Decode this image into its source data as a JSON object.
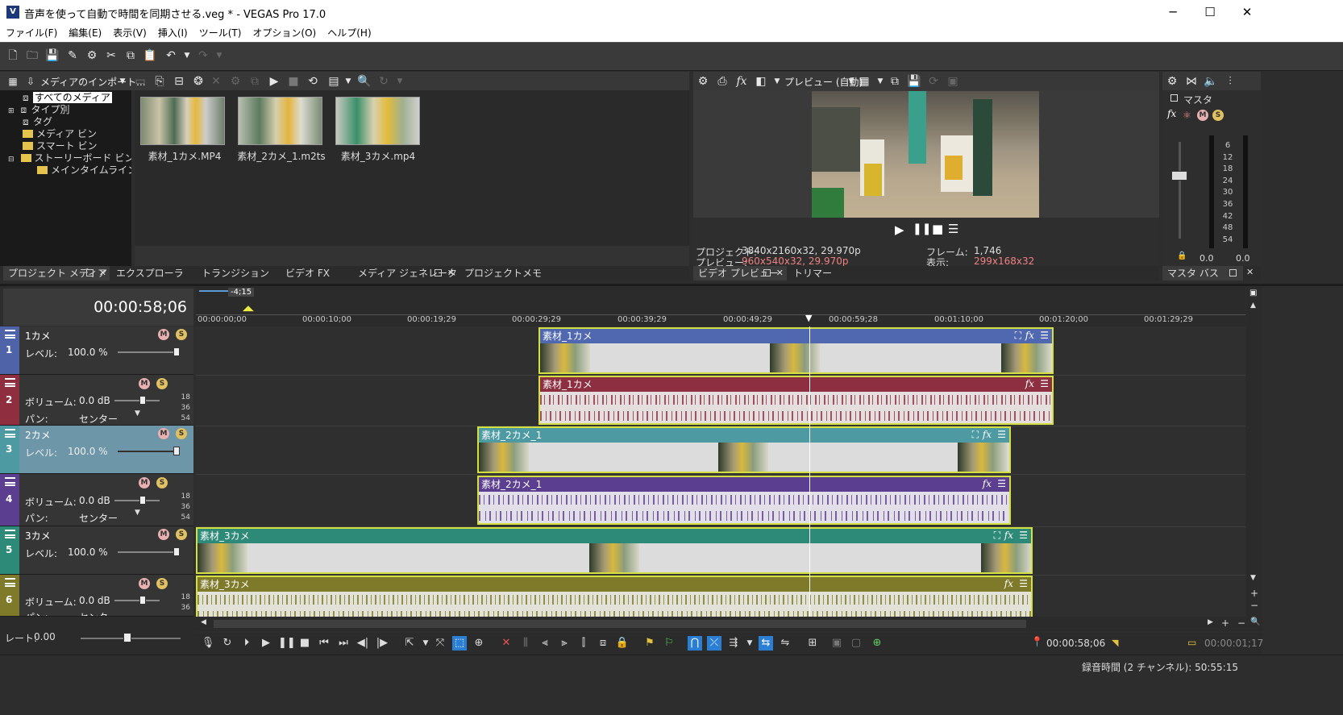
{
  "window": {
    "title": "音声を使って自動で時間を同期させる.veg * - VEGAS Pro 17.0",
    "app_icon": "V"
  },
  "menu": [
    "ファイル(F)",
    "編集(E)",
    "表示(V)",
    "挿入(I)",
    "ツール(T)",
    "オプション(O)",
    "ヘルプ(H)"
  ],
  "media_panel": {
    "import_label": "メディアのインポート...",
    "tree": [
      "すべてのメディア",
      "タイプ別",
      "タグ",
      "メディア ビン",
      "スマート ビン",
      "ストーリーボード ビン",
      "メインタイムライン"
    ],
    "files": [
      "素材_1カメ.MP4",
      "素材_2カメ_1.m2ts",
      "素材_3カメ.mp4"
    ]
  },
  "lower_tabs": [
    "プロジェクト メディア",
    "エクスプローラ",
    "トランジション",
    "ビデオ FX",
    "メディア ジェネレータ",
    "プロジェクトメモ"
  ],
  "preview": {
    "mode_label": "プレビュー (自動)",
    "project_label": "プロジェクト:",
    "project_value": "3840x2160x32, 29.970p",
    "preview_label": "プレビュー:",
    "preview_value": "960x540x32, 29.970p",
    "frame_label": "フレーム:",
    "frame_value": "1,746",
    "display_label": "表示:",
    "display_value": "299x168x32",
    "tabs": [
      "ビデオ プレビュー",
      "トリマー"
    ]
  },
  "master": {
    "label": "マスタ",
    "tab": "マスタ バス",
    "scale": [
      "6",
      "12",
      "18",
      "24",
      "30",
      "36",
      "42",
      "48",
      "54"
    ],
    "left": "0.0",
    "right": "0.0"
  },
  "timeline": {
    "timecode": "00:00:58;06",
    "loop_label": "-4;15",
    "ruler": [
      "00:00:00;00",
      "00:00:10;00",
      "00:00:19;29",
      "00:00:29;29",
      "00:00:39;29",
      "00:00:49;29",
      "00:00:59;28",
      "00:01:10;00",
      "00:01:20;00",
      "00:01:29;29"
    ],
    "tracks": [
      {
        "num": "1",
        "name": "1カメ",
        "kind": "video",
        "level_label": "レベル:",
        "level": "100.0 %"
      },
      {
        "num": "2",
        "name": "",
        "kind": "audio",
        "vol_label": "ボリューム:",
        "vol": "0.0 dB",
        "pan_label": "パン:",
        "pan": "センター"
      },
      {
        "num": "3",
        "name": "2カメ",
        "kind": "video",
        "level_label": "レベル:",
        "level": "100.0 %"
      },
      {
        "num": "4",
        "name": "",
        "kind": "audio",
        "vol_label": "ボリューム:",
        "vol": "0.0 dB",
        "pan_label": "パン:",
        "pan": "センター"
      },
      {
        "num": "5",
        "name": "3カメ",
        "kind": "video",
        "level_label": "レベル:",
        "level": "100.0 %"
      },
      {
        "num": "6",
        "name": "",
        "kind": "audio",
        "vol_label": "ボリューム:",
        "vol": "0.0 dB",
        "pan_label": "パン:",
        "pan": "センター"
      }
    ],
    "meter_scale": [
      "18",
      "36",
      "54"
    ],
    "clips": [
      "素材_1カメ",
      "素材_1カメ",
      "素材_2カメ_1",
      "素材_2カメ_1",
      "素材_3カメ",
      "素材_3カメ"
    ],
    "rate_label": "レート:",
    "rate": "0.00",
    "cursor_time": "00:00:58;06",
    "end_time": "00:00:01;17"
  },
  "status": {
    "record_time": "録音時間 (2 チャンネル): 50:55:15"
  },
  "colors": {
    "track1": "#4f63a8",
    "track2": "#8f2e3f",
    "track3": "#4d9aa3",
    "track4": "#5b3e8f",
    "track5": "#2e8a78",
    "track6": "#7e7a2a",
    "selected_header": "#6d96a8"
  }
}
